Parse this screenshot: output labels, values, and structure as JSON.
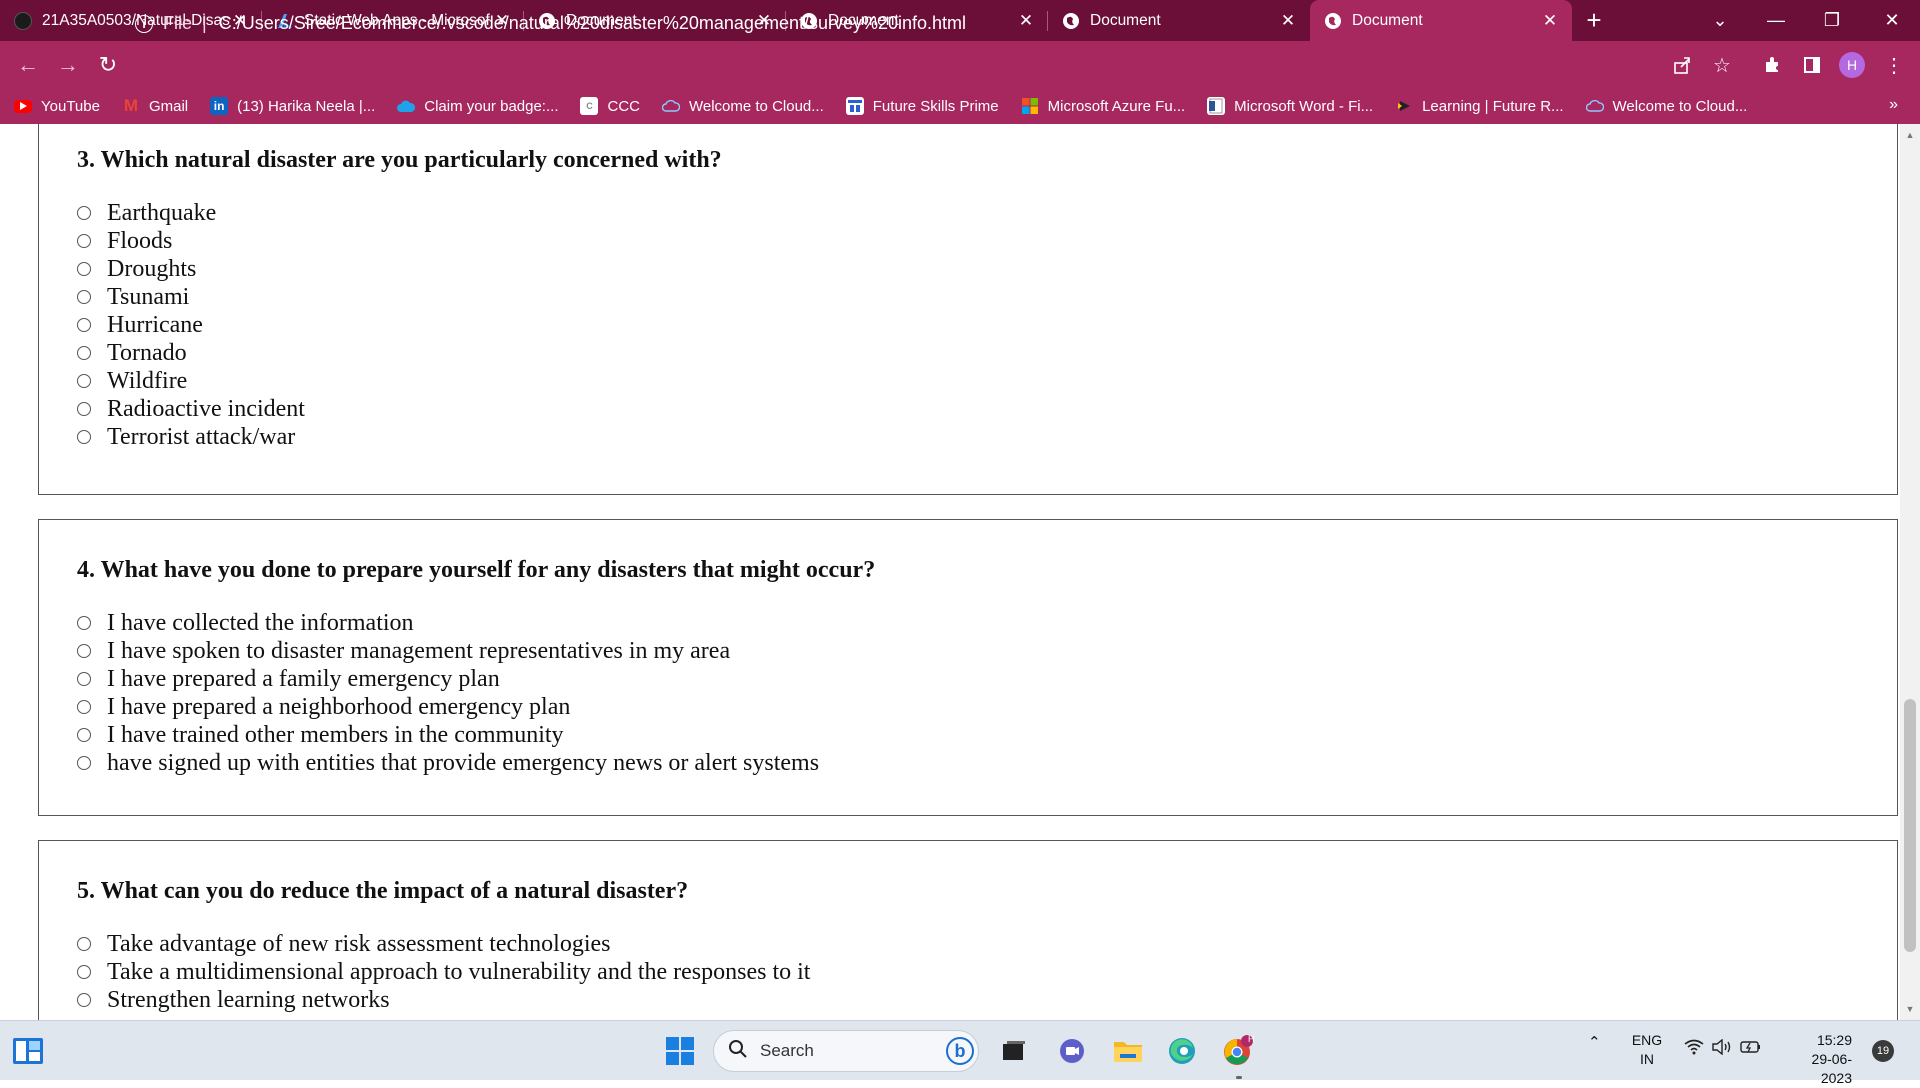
{
  "browser": {
    "tabs": [
      {
        "label": "21A35A0503/Natural-Disas",
        "icon": "github-icon"
      },
      {
        "label": "Static Web Apps - Microsof",
        "icon": "azure-icon"
      },
      {
        "label": "Document",
        "icon": "globe-icon"
      },
      {
        "label": "Document",
        "icon": "globe-icon"
      },
      {
        "label": "Document",
        "icon": "globe-icon"
      },
      {
        "label": "Document",
        "icon": "globe-icon",
        "active": true
      }
    ],
    "close_glyph": "✕",
    "new_tab_glyph": "+",
    "scheme": "File",
    "url": "C:/Users/Siree/Ecommerce/.vscode/natural%20disaster%20management/survey%20info.html",
    "profile_initial": "H",
    "accent_color": "#a6285f",
    "tabstrip_color": "#6b0f38"
  },
  "bookmarks": [
    {
      "label": "YouTube",
      "icon": "youtube-icon"
    },
    {
      "label": "Gmail",
      "icon": "gmail-icon"
    },
    {
      "label": "(13) Harika Neela |...",
      "icon": "linkedin-icon"
    },
    {
      "label": "Claim your badge:...",
      "icon": "cloud-icon"
    },
    {
      "label": "CCC",
      "icon": "ccc-icon"
    },
    {
      "label": "Welcome to Cloud...",
      "icon": "cloud-outline-icon"
    },
    {
      "label": "Future Skills Prime",
      "icon": "fsp-icon"
    },
    {
      "label": "Microsoft Azure Fu...",
      "icon": "microsoft-icon"
    },
    {
      "label": "Microsoft Word - Fi...",
      "icon": "word-doc-icon"
    },
    {
      "label": "Learning | Future R...",
      "icon": "learning-icon"
    },
    {
      "label": "Welcome to Cloud...",
      "icon": "cloud-outline-icon"
    }
  ],
  "bookmarks_more": "»",
  "survey": {
    "questions": [
      {
        "title": "3. Which natural disaster are you particularly concerned with?",
        "options": [
          "Earthquake",
          "Floods",
          "Droughts",
          "Tsunami",
          "Hurricane",
          "Tornado",
          "Wildfire",
          "Radioactive incident",
          "Terrorist attack/war"
        ]
      },
      {
        "title": "4. What have you done to prepare yourself for any disasters that might occur?",
        "options": [
          "I have collected the information",
          "I have spoken to disaster management representatives in my area",
          "I have prepared a family emergency plan",
          "I have prepared a neighborhood emergency plan",
          "I have trained other members in the community",
          "have signed up with entities that provide emergency news or alert systems"
        ]
      },
      {
        "title": "5. What can you do reduce the impact of a natural disaster?",
        "options": [
          "Take advantage of new risk assessment technologies",
          "Take a multidimensional approach to vulnerability and the responses to it",
          "Strengthen learning networks"
        ]
      }
    ]
  },
  "taskbar": {
    "search_placeholder": "Search",
    "language": "ENG",
    "region": "IN",
    "time": "15:29",
    "date": "29-06-2023",
    "notification_count": "19",
    "chrome_badge": "H",
    "bing_glyph": "b"
  }
}
